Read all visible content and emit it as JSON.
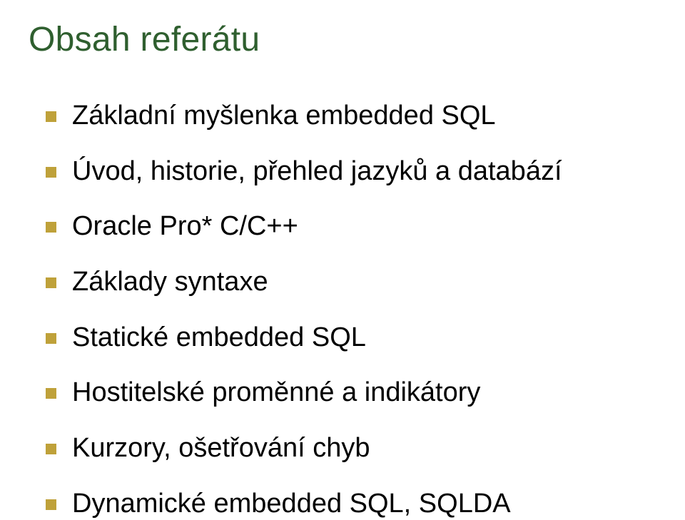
{
  "title": "Obsah referátu",
  "items": [
    {
      "label": "Základní myšlenka embedded SQL"
    },
    {
      "label": "Úvod, historie, přehled jazyků a databází"
    },
    {
      "label": "Oracle Pro* C/C++"
    },
    {
      "label": "Základy syntaxe"
    },
    {
      "label": "Statické embedded SQL"
    },
    {
      "label": "Hostitelské proměnné a indikátory"
    },
    {
      "label": "Kurzory, ošetřování chyb"
    },
    {
      "label": "Dynamické embedded SQL, SQLDA"
    }
  ]
}
